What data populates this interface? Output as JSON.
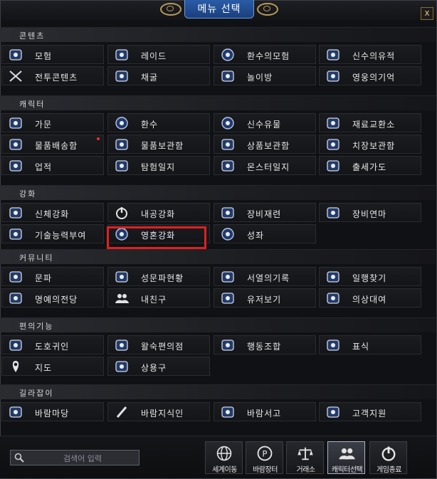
{
  "window": {
    "title": "메뉴 선택",
    "close_label": "x"
  },
  "sections": [
    {
      "title": "콘텐츠",
      "items": [
        {
          "label": "모험",
          "icon": "adventure-icon"
        },
        {
          "label": "레이드",
          "icon": "raid-icon"
        },
        {
          "label": "환수의모험",
          "icon": "spirit-adventure-icon"
        },
        {
          "label": "신수의유적",
          "icon": "divine-ruins-icon"
        },
        {
          "label": "전투콘텐츠",
          "icon": "crossed-swords-icon"
        },
        {
          "label": "채굴",
          "icon": "mining-icon"
        },
        {
          "label": "놀이방",
          "icon": "playroom-icon"
        },
        {
          "label": "영웅의기억",
          "icon": "book-icon"
        }
      ]
    },
    {
      "title": "캐릭터",
      "items": [
        {
          "label": "가문",
          "icon": "family-icon"
        },
        {
          "label": "환수",
          "icon": "spirit-beast-icon"
        },
        {
          "label": "신수유물",
          "icon": "relic-icon"
        },
        {
          "label": "재료교환소",
          "icon": "exchange-icon"
        },
        {
          "label": "물품배송함",
          "icon": "delivery-icon",
          "notify": true
        },
        {
          "label": "물품보관함",
          "icon": "storage-chest-icon"
        },
        {
          "label": "상품보관함",
          "icon": "product-storage-icon"
        },
        {
          "label": "치장보관함",
          "icon": "costume-storage-icon"
        },
        {
          "label": "업적",
          "icon": "achievement-icon"
        },
        {
          "label": "탐험일지",
          "icon": "exploration-icon"
        },
        {
          "label": "몬스터일지",
          "icon": "monster-icon"
        },
        {
          "label": "출세가도",
          "icon": "career-icon"
        }
      ]
    },
    {
      "title": "강화",
      "items": [
        {
          "label": "신체강화",
          "icon": "body-enhance-icon"
        },
        {
          "label": "내공강화",
          "icon": "inner-power-icon"
        },
        {
          "label": "장비재련",
          "icon": "equipment-refine-icon"
        },
        {
          "label": "장비연마",
          "icon": "equipment-polish-icon"
        },
        {
          "label": "기술능력부여",
          "icon": "skill-enchant-icon"
        },
        {
          "label": "영혼강화",
          "icon": "soul-enhance-icon",
          "selected": true
        },
        {
          "label": "성좌",
          "icon": "constellation-icon"
        }
      ]
    },
    {
      "title": "커뮤니티",
      "items": [
        {
          "label": "문파",
          "icon": "guild-icon"
        },
        {
          "label": "성문파현황",
          "icon": "castle-guild-icon"
        },
        {
          "label": "서열의기록",
          "icon": "ranking-icon"
        },
        {
          "label": "일행찾기",
          "icon": "party-search-icon"
        },
        {
          "label": "명예의전당",
          "icon": "hall-of-fame-icon"
        },
        {
          "label": "내친구",
          "icon": "friends-icon"
        },
        {
          "label": "유저보기",
          "icon": "user-search-icon"
        },
        {
          "label": "의상대여",
          "icon": "costume-rental-icon"
        }
      ]
    },
    {
      "title": "편의기능",
      "items": [
        {
          "label": "도호귀인",
          "icon": "guide-npc-icon"
        },
        {
          "label": "왈숙편의점",
          "icon": "convenience-store-icon"
        },
        {
          "label": "행동조합",
          "icon": "action-combo-icon"
        },
        {
          "label": "표식",
          "icon": "marker-icon"
        },
        {
          "label": "지도",
          "icon": "map-pin-icon"
        },
        {
          "label": "상용구",
          "icon": "phrase-icon"
        }
      ]
    },
    {
      "title": "길라잡이",
      "items": [
        {
          "label": "바람마당",
          "icon": "baram-plaza-icon"
        },
        {
          "label": "바람지식인",
          "icon": "pen-icon"
        },
        {
          "label": "바람서고",
          "icon": "library-icon"
        },
        {
          "label": "고객지원",
          "icon": "support-icon"
        }
      ]
    }
  ],
  "search": {
    "placeholder": "검색어 입력",
    "value": ""
  },
  "quick_buttons": [
    {
      "label": "세계이동",
      "icon": "globe-icon"
    },
    {
      "label": "바람장터",
      "icon": "market-coin-icon"
    },
    {
      "label": "거래소",
      "icon": "scales-icon"
    },
    {
      "label": "캐릭터선택",
      "icon": "character-select-icon",
      "active": true
    },
    {
      "label": "게임종료",
      "icon": "power-icon"
    }
  ],
  "colors": {
    "accent": "#1a3f7c",
    "selected_outline": "#e02020",
    "notify": "#ff2a2a"
  }
}
